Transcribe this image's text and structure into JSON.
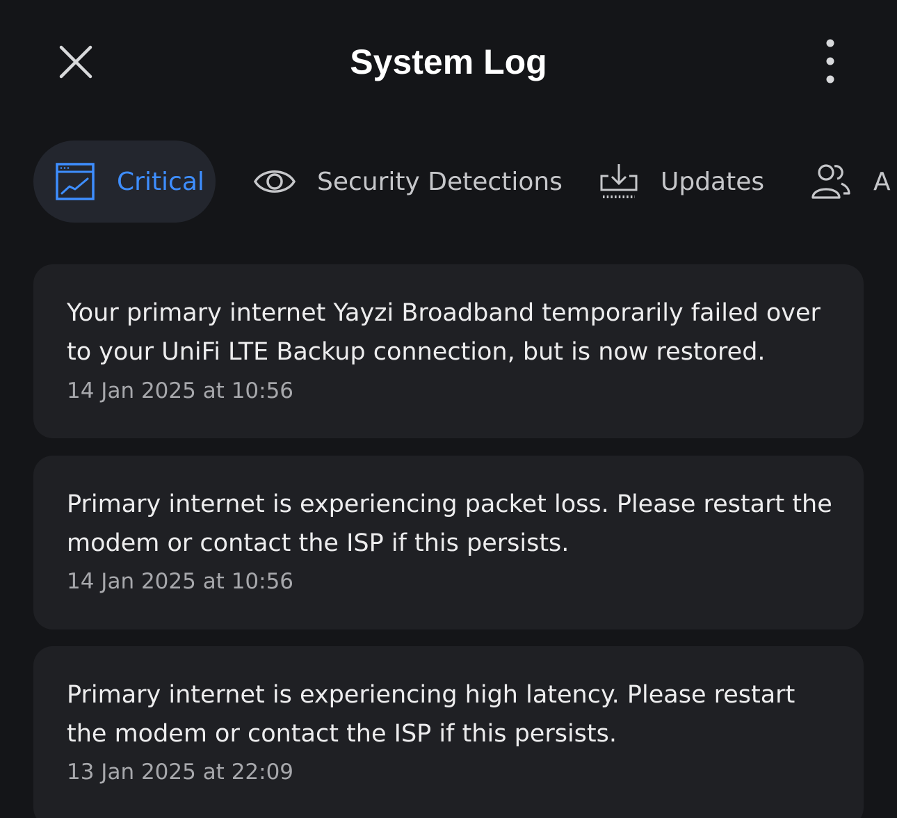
{
  "header": {
    "title": "System Log",
    "close_icon": "close-icon",
    "more_icon": "more-vertical-icon"
  },
  "tabs": [
    {
      "label": "Critical",
      "icon": "chart-window-icon",
      "active": true
    },
    {
      "label": "Security Detections",
      "icon": "eye-icon",
      "active": false
    },
    {
      "label": "Updates",
      "icon": "download-tray-icon",
      "active": false
    },
    {
      "label": "A",
      "icon": "users-icon",
      "active": false
    }
  ],
  "logs": [
    {
      "message": "Your primary internet Yayzi Broadband temporarily failed over to your UniFi LTE Backup connection, but is now restored.",
      "time": "14 Jan 2025 at 10:56"
    },
    {
      "message": "Primary internet is experiencing packet loss. Please restart the modem or contact the ISP if this persists.",
      "time": "14 Jan 2025 at 10:56"
    },
    {
      "message": "Primary internet is experiencing high latency. Please restart the modem or contact the ISP if this persists.",
      "time": "13 Jan 2025 at 22:09"
    }
  ],
  "colors": {
    "background": "#141518",
    "card": "#1f2024",
    "accent": "#3e8eff",
    "active_tab_bg": "#23262e"
  }
}
